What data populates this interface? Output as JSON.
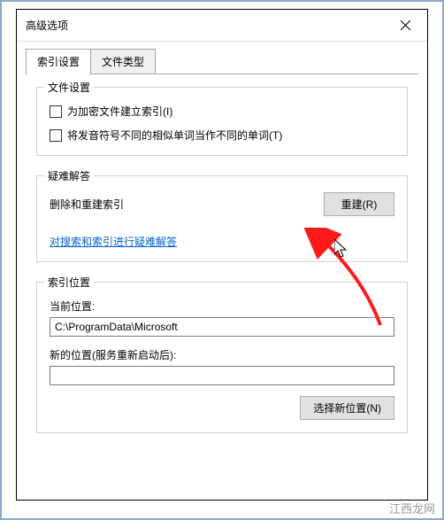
{
  "window": {
    "title": "高级选项"
  },
  "tabs": {
    "index_settings": "索引设置",
    "file_types": "文件类型"
  },
  "file_settings": {
    "group_title": "文件设置",
    "encrypt_index": "为加密文件建立索引(I)",
    "treat_similar": "将发音符号不同的相似单词当作不同的单词(T)"
  },
  "troubleshoot": {
    "group_title": "疑难解答",
    "delete_rebuild": "删除和重建索引",
    "rebuild_btn": "重建(R)",
    "help_link": "对搜索和索引进行疑难解答"
  },
  "index_location": {
    "group_title": "索引位置",
    "current_label": "当前位置:",
    "current_value": "C:\\ProgramData\\Microsoft",
    "new_label": "新的位置(服务重新启动后):",
    "new_value": "",
    "choose_btn": "选择新位置(N)"
  },
  "watermark": "江西龙网"
}
